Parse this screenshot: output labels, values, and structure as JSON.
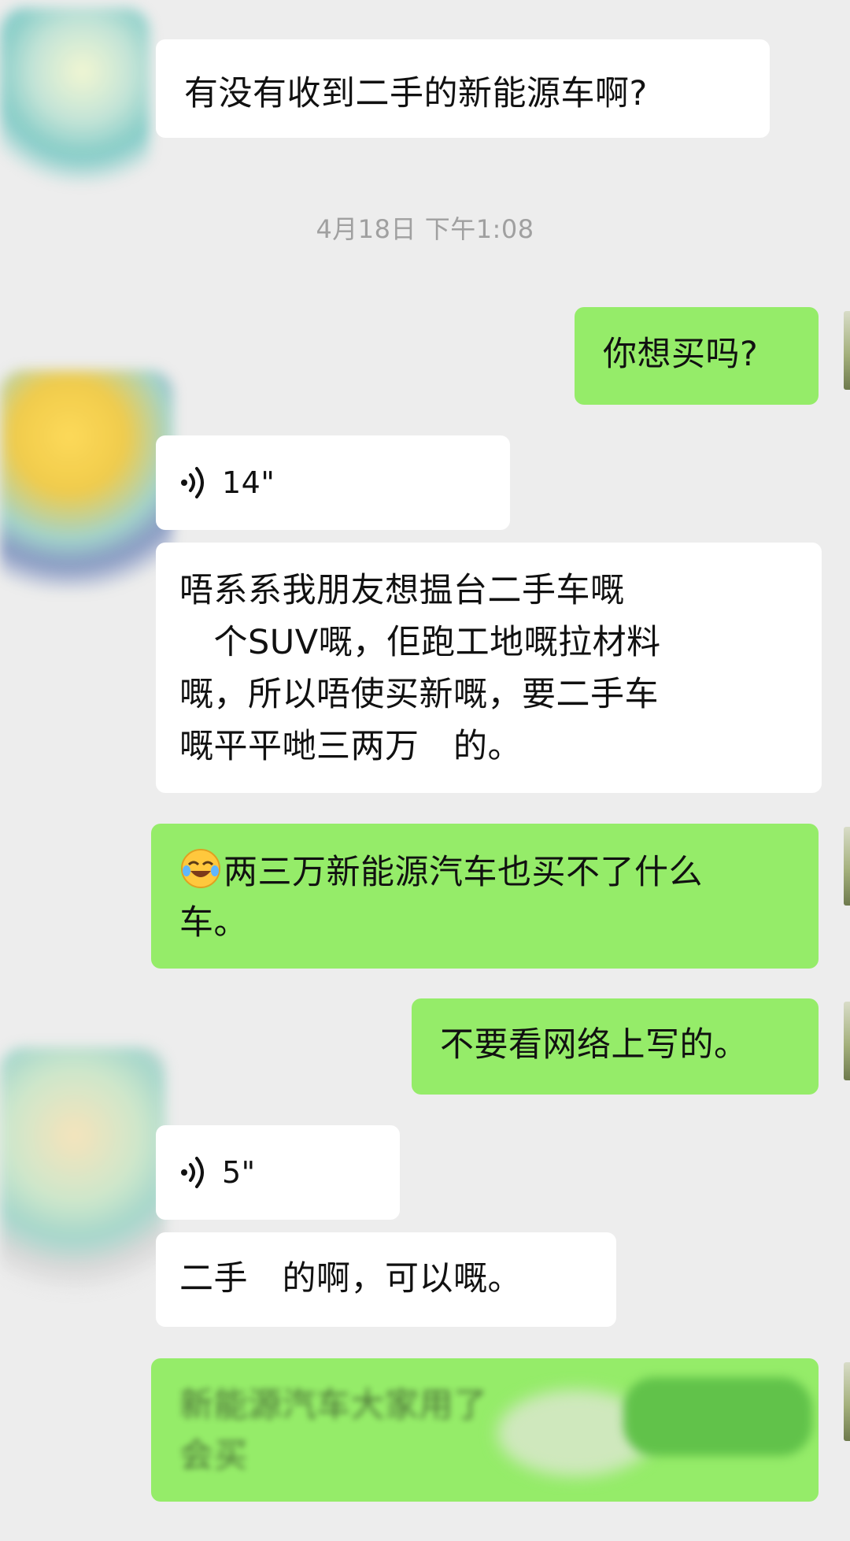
{
  "chat": {
    "messages": [
      {
        "side": "in",
        "text": "有没有收到二手的新能源车啊?"
      },
      {
        "side": "time",
        "text": "4月18日 下午1:08"
      },
      {
        "side": "out",
        "text": "你想买吗?"
      },
      {
        "side": "in_voice",
        "duration": "14\""
      },
      {
        "side": "in",
        "lines": [
          "唔系系我朋友想揾台二手车嘅",
          "　个SUV嘅，佢跑工地嘅拉材料",
          "嘅，所以唔使买新嘅，要二手车",
          "嘅平平哋三两万　的。"
        ]
      },
      {
        "side": "out",
        "emoji": "face-with-tears-of-joy-icon",
        "lines": [
          "两三万新能源汽车也买不了什么",
          "车。"
        ]
      },
      {
        "side": "out",
        "text": "不要看网络上写的。"
      },
      {
        "side": "in_voice",
        "duration": "5\""
      },
      {
        "side": "in",
        "text": "二手　的啊，可以嘅。"
      },
      {
        "side": "out",
        "lines": [
          "新能源汽车大家用了",
          "会买"
        ]
      }
    ]
  },
  "colors": {
    "background": "#EDEDED",
    "incoming_bubble": "#FFFFFF",
    "outgoing_bubble": "#95EC69",
    "timestamp_text": "#A0A0A0"
  }
}
